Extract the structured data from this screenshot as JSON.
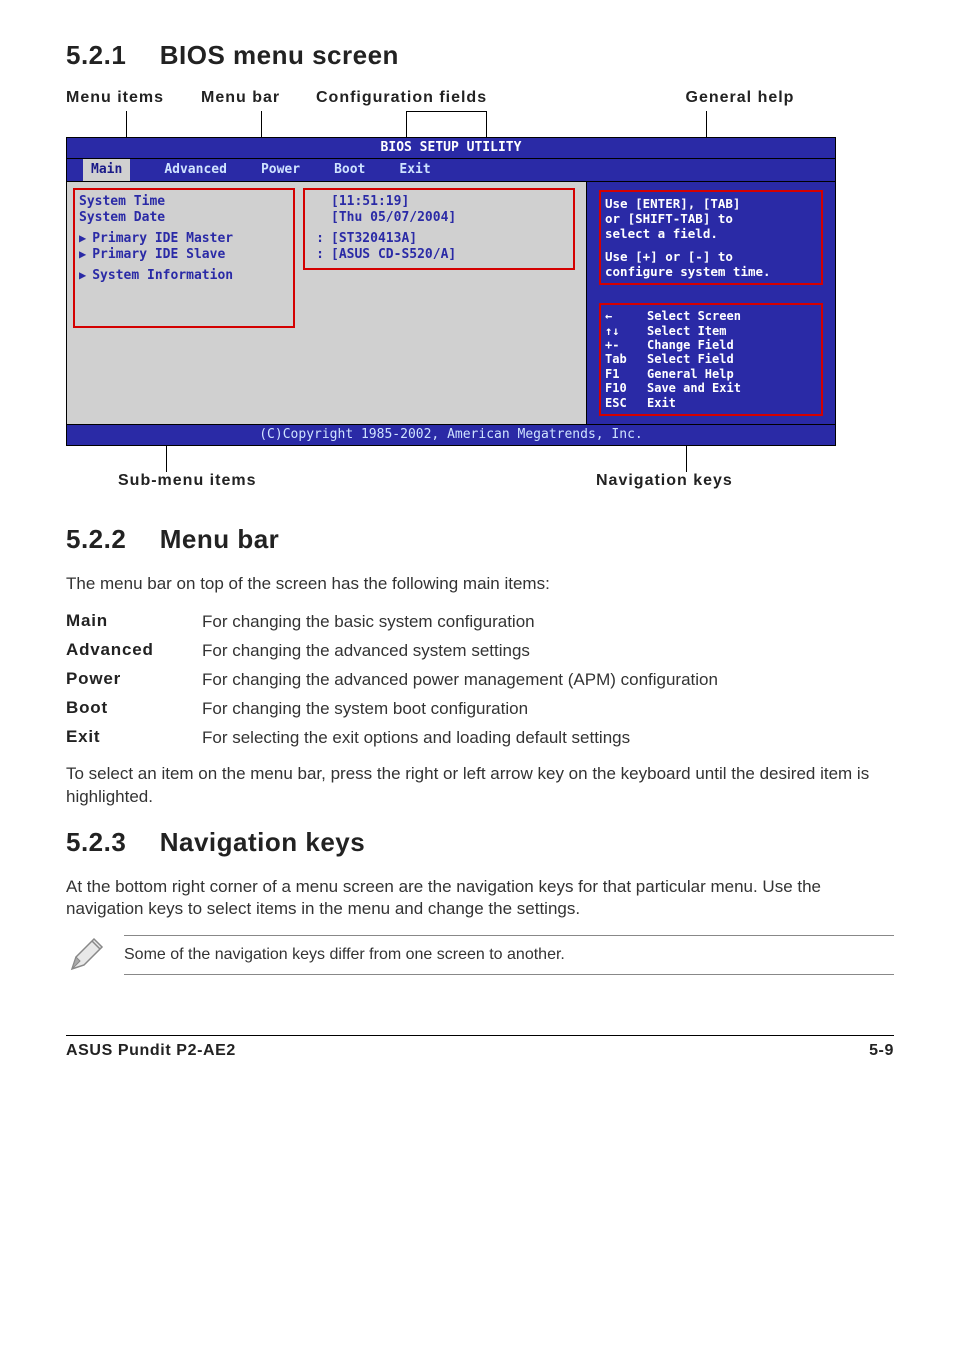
{
  "section_521": {
    "num": "5.2.1",
    "title": "BIOS menu screen"
  },
  "topLabels": {
    "menuItems": "Menu items",
    "menuBar": "Menu bar",
    "configFields": "Configuration fields",
    "generalHelp": "General help"
  },
  "bios": {
    "headerTitle": "BIOS SETUP UTILITY",
    "menubar": [
      "Main",
      "Advanced",
      "Power",
      "Boot",
      "Exit"
    ],
    "leftItems": {
      "systemTime": "System Time",
      "systemDate": "System Date",
      "primaryMaster": "Primary IDE Master",
      "primarySlave": "Primary IDE Slave",
      "systemInfo": "System Information"
    },
    "values": {
      "time": "[11:51:19]",
      "date": "[Thu 05/07/2004]",
      "masterColon": ":",
      "master": "[ST320413A]",
      "slaveColon": ":",
      "slave": "[ASUS CD-S520/A]"
    },
    "help": {
      "l1": "Use [ENTER], [TAB]",
      "l2": "or [SHIFT-TAB] to",
      "l3": "select a field.",
      "l4": "Use [+] or [-] to",
      "l5": "configure system time."
    },
    "nav": [
      {
        "k": "←",
        "v": "Select Screen"
      },
      {
        "k": "↑↓",
        "v": "Select Item"
      },
      {
        "k": "+-",
        "v": "Change Field"
      },
      {
        "k": "Tab",
        "v": "Select Field"
      },
      {
        "k": "F1",
        "v": "General Help"
      },
      {
        "k": "F10",
        "v": "Save and Exit"
      },
      {
        "k": "ESC",
        "v": "Exit"
      }
    ],
    "copyright": "(C)Copyright 1985-2002, American Megatrends, Inc."
  },
  "bottomLabels": {
    "submenu": "Sub-menu items",
    "navkeys": "Navigation keys"
  },
  "section_522": {
    "num": "5.2.2",
    "title": "Menu bar"
  },
  "menubarIntro": "The menu bar on top of the screen has the following main items:",
  "menubarItems": [
    {
      "k": "Main",
      "v": "For changing the basic system configuration"
    },
    {
      "k": "Advanced",
      "v": "For changing the advanced system settings"
    },
    {
      "k": "Power",
      "v": "For changing the advanced power management (APM) configuration"
    },
    {
      "k": "Boot",
      "v": "For changing the system boot configuration"
    },
    {
      "k": "Exit",
      "v": "For selecting the exit options and loading default settings"
    }
  ],
  "menubarOutro": "To select an item on the menu bar, press the right or left arrow key on the keyboard until the desired item is highlighted.",
  "section_523": {
    "num": "5.2.3",
    "title": "Navigation keys"
  },
  "navkeysBody": "At the bottom right corner of a menu screen are the navigation keys for that particular menu. Use the navigation keys to select items in the menu and change the settings.",
  "noteText": "Some of the navigation keys differ from one screen to another.",
  "footerLeft": "ASUS Pundit P2-AE2",
  "footerRight": "5-9"
}
